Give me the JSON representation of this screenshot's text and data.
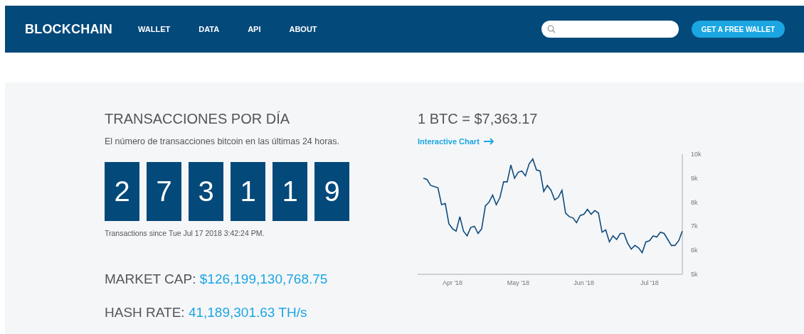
{
  "header": {
    "logo": "BLOCKCHAIN",
    "nav": [
      {
        "label": "WALLET"
      },
      {
        "label": "DATA"
      },
      {
        "label": "API"
      },
      {
        "label": "ABOUT"
      }
    ],
    "cta": "GET A FREE WALLET"
  },
  "transactions": {
    "title": "TRANSACCIONES POR DÍA",
    "subtitle": "El número de transacciones bitcoin en las últimas 24 horas.",
    "digits": [
      "2",
      "7",
      "3",
      "1",
      "1",
      "9"
    ],
    "since": "Transactions since Tue Jul 17 2018 3:42:24 PM."
  },
  "stats": [
    {
      "label": "MARKET CAP:",
      "value": "$126,199,130,768.75"
    },
    {
      "label": "HASH RATE:",
      "value": "41,189,301.63 TH/s"
    }
  ],
  "price": {
    "title": "1 BTC = $7,363.17",
    "link": "Interactive Chart",
    "chart_data": {
      "type": "line",
      "ylim": [
        5000,
        10000
      ],
      "yticks": [
        {
          "value": 5000,
          "label": "5k"
        },
        {
          "value": 6000,
          "label": "6k"
        },
        {
          "value": 7000,
          "label": "7k"
        },
        {
          "value": 8000,
          "label": "8k"
        },
        {
          "value": 9000,
          "label": "9k"
        },
        {
          "value": 10000,
          "label": "10k"
        }
      ],
      "categories": [
        null,
        null,
        null,
        null,
        null,
        null,
        null,
        null,
        "Apr '18",
        null,
        null,
        null,
        null,
        null,
        null,
        null,
        null,
        null,
        null,
        null,
        null,
        null,
        null,
        null,
        null,
        null,
        "May '18",
        null,
        null,
        null,
        null,
        null,
        null,
        null,
        null,
        null,
        null,
        null,
        null,
        null,
        null,
        null,
        null,
        null,
        "Jun '18",
        null,
        null,
        null,
        null,
        null,
        null,
        null,
        null,
        null,
        null,
        null,
        null,
        null,
        null,
        null,
        null,
        null,
        "Jul '18",
        null,
        null,
        null,
        null,
        null,
        null,
        null,
        null,
        null
      ],
      "series": [
        {
          "color": "#0e4c7d",
          "values": [
            9000,
            8950,
            8700,
            8650,
            8600,
            7900,
            7950,
            7100,
            6900,
            6800,
            7400,
            6800,
            6600,
            6950,
            7000,
            6700,
            6900,
            7850,
            8000,
            8300,
            7900,
            8200,
            8850,
            8850,
            9550,
            9000,
            9250,
            9300,
            9100,
            9600,
            9800,
            9350,
            9300,
            8450,
            8700,
            8500,
            8100,
            8200,
            8500,
            7550,
            7400,
            7350,
            7150,
            7450,
            7500,
            7700,
            7500,
            7650,
            7550,
            6750,
            6850,
            6350,
            6600,
            6450,
            6700,
            6700,
            6300,
            6050,
            6200,
            6100,
            5900,
            6350,
            6400,
            6600,
            6550,
            6750,
            6700,
            6450,
            6200,
            6200,
            6400,
            6800
          ]
        }
      ]
    }
  }
}
